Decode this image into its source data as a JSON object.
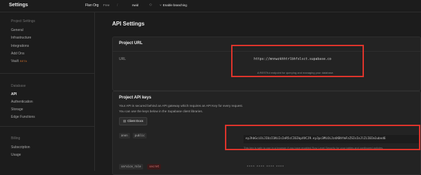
{
  "topbar": {
    "title": "Settings",
    "org": "Flan Org",
    "plan": "Free",
    "separator": "/",
    "project": "nwid",
    "chevron": "◇",
    "branching": "Enable branching",
    "branch_icon": "git-branch-icon"
  },
  "sidebar": {
    "groups": [
      "Project Settings",
      "Database",
      "Billing"
    ],
    "items": [
      "General",
      "Infrastructure",
      "Integrations",
      "Add Ons",
      "Vault",
      "API",
      "Authentication",
      "Storage",
      "Edge Functions",
      "Subscription",
      "Usage"
    ],
    "beta_badge": "BETA"
  },
  "main": {
    "title": "API Settings",
    "project_url": {
      "header": "Project URL",
      "label": "URL",
      "value": "https://mnnwzkhhtrlbhfxlsct.supabase.co",
      "help": "A RESTful endpoint for querying and managing your database."
    },
    "api_keys": {
      "header": "Project API keys",
      "description_1": "Your API is secured behind an API gateway which requires an API Key for every request.",
      "description_2": "You can use the keys below in the Supabase client libraries.",
      "client_docs_button": "Client Docs",
      "anon_tag": "anon",
      "public_tag": "public",
      "anon_key": "eyJhbGciOiJIUzI1NiIsInR5cCI6IkpXVCJ9.eyJpc3MiOiJzdXBhYmFzZSIsInJlZiI6Im1ubnd6",
      "anon_help": "This key is safe to use in a browser if you have enabled Row Level Security for your tables and configured policies.",
      "service_tag": "service_role",
      "secret_tag": "secret",
      "service_masked": "**** **** **** ****"
    }
  },
  "colors": {
    "background": "#1c1c1c",
    "card": "#232323",
    "highlight": "#e0342b",
    "beta": "#c46a2a"
  }
}
